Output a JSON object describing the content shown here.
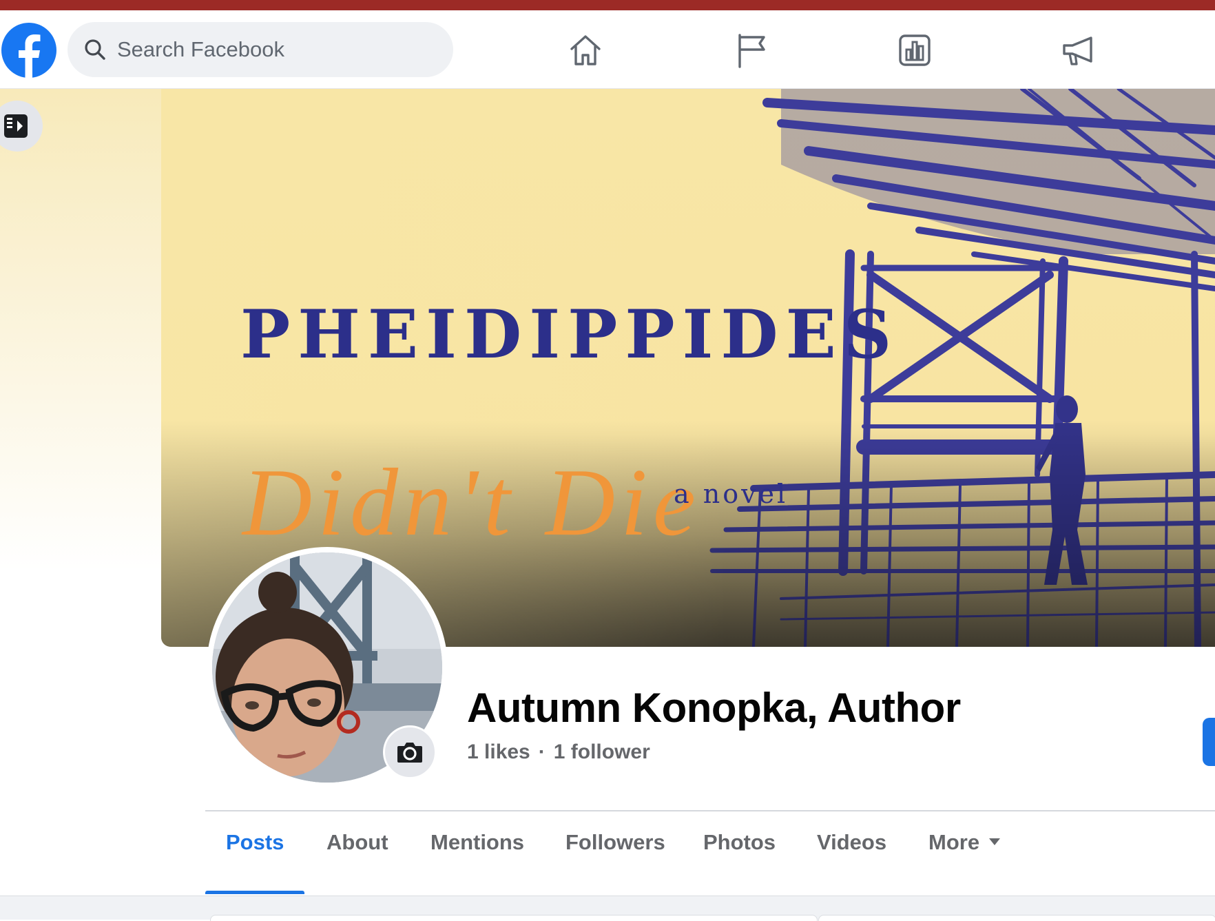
{
  "search": {
    "placeholder": "Search Facebook"
  },
  "nav": [
    {
      "icon": "home-icon"
    },
    {
      "icon": "flag-icon"
    },
    {
      "icon": "insights-icon"
    },
    {
      "icon": "megaphone-icon"
    }
  ],
  "cover": {
    "title": "PHEIDIPPIDES",
    "script": "Didn't Die",
    "subtitle": "a novel"
  },
  "profile": {
    "name": "Autumn Konopka, Author",
    "likes": "1 likes",
    "separator": "·",
    "followers": "1 follower"
  },
  "tabs": [
    {
      "label": "Posts",
      "active": true
    },
    {
      "label": "About"
    },
    {
      "label": "Mentions"
    },
    {
      "label": "Followers"
    },
    {
      "label": "Photos"
    },
    {
      "label": "Videos"
    },
    {
      "label": "More"
    }
  ],
  "colors": {
    "accent": "#1b74e4",
    "cover_background": "#f8e6a6",
    "cover_ink": "#2c2f8a",
    "cover_script": "#f0963a",
    "browser_strip": "#9c2a26"
  }
}
